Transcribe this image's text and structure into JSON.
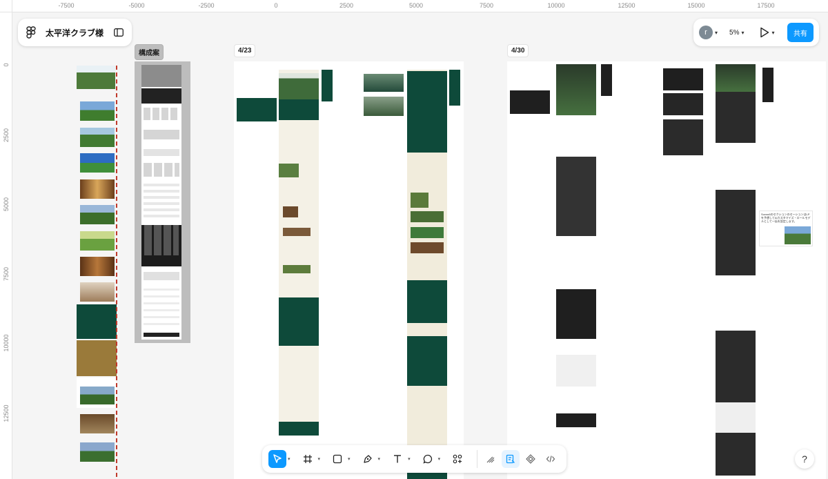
{
  "file": {
    "name": "太平洋クラブ様"
  },
  "ruler": {
    "top_ticks": [
      "-7500",
      "-5000",
      "-2500",
      "0",
      "2500",
      "5000",
      "7500",
      "10000",
      "12500",
      "15000",
      "17500"
    ],
    "left_ticks": [
      "0",
      "2500",
      "5000",
      "7500",
      "10000",
      "12500"
    ]
  },
  "frames": {
    "structure_label": "構成案",
    "apr23_label": "4/23",
    "apr30_label": "4/30"
  },
  "header": {
    "avatar_letter": "r",
    "zoom_level": "5%",
    "share_label": "共有"
  },
  "note": {
    "text": "Scene8のセクションのセーションはLPを予想してAIカスタマイズ・ロールモデルとして一括を設定します。"
  },
  "toolbar": {
    "tools": [
      "move-tool",
      "frame-tool",
      "shape-tool",
      "pen-tool",
      "text-tool",
      "comment-tool",
      "actions-tool"
    ],
    "active_tool": "move-tool",
    "modes": [
      "draw-mode",
      "design-mode",
      "prototype-mode",
      "dev-mode"
    ],
    "active_mode": "design-mode"
  },
  "help": {
    "label": "?"
  },
  "colors": {
    "accent": "#0d99ff",
    "forest_green": "#0e4a3a",
    "dark": "#2b2b2b",
    "cream": "#f4f1e6",
    "dashed_red": "#c0392b"
  }
}
